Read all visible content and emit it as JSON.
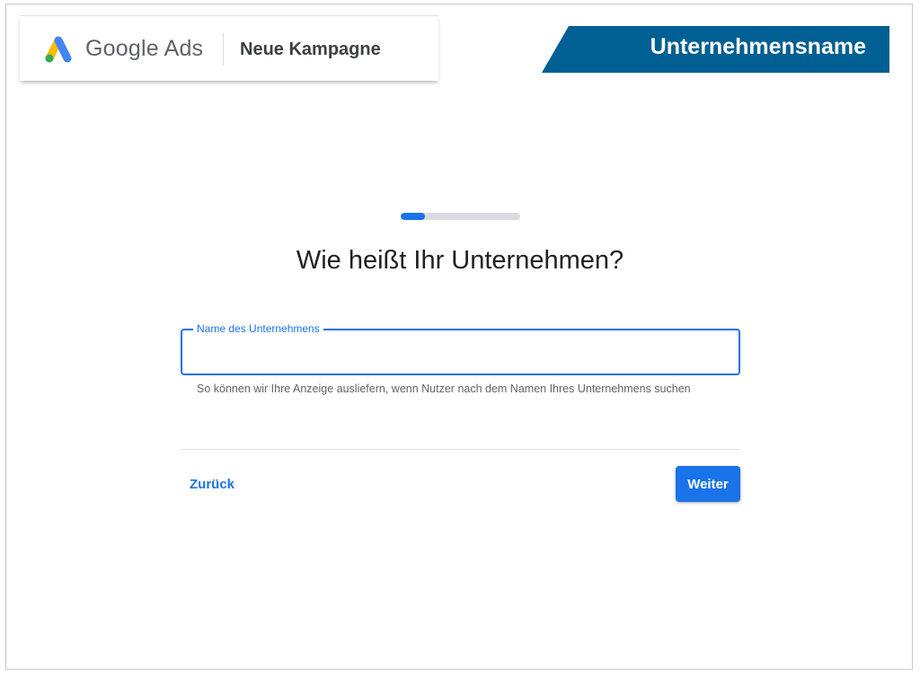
{
  "header": {
    "brand": "Google Ads",
    "campaign_title": "Neue Kampagne",
    "logo_icon": "google-ads-logo-icon"
  },
  "company_banner": {
    "label": "Unternehmensname",
    "color": "#005f93"
  },
  "progress": {
    "value_percent": 20
  },
  "form": {
    "question": "Wie heißt Ihr Unternehmen?",
    "field_label": "Name des Unternehmens",
    "field_value": "",
    "helper_text": "So können wir Ihre Anzeige ausliefern, wenn Nutzer nach dem Namen Ihres Unternehmens suchen"
  },
  "actions": {
    "back_label": "Zurück",
    "next_label": "Weiter"
  },
  "colors": {
    "accent": "#1a73e8",
    "track": "#dadce0"
  }
}
